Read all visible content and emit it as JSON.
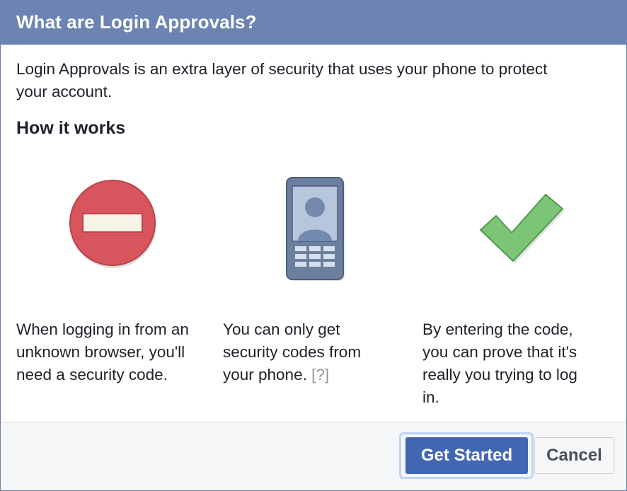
{
  "dialog": {
    "title": "What are Login Approvals?",
    "intro_line1": "Login Approvals is an extra layer of security that uses your phone to protect",
    "intro_line2": "your account.",
    "section_heading": "How it works"
  },
  "steps": [
    {
      "icon": "no-entry-icon",
      "line1": "When logging in from an",
      "line2": "unknown browser, you'll",
      "line3": "need a security code."
    },
    {
      "icon": "phone-icon",
      "line1": "You can only get",
      "line2": "security codes from",
      "line3": "your phone.",
      "help_link": "[?]"
    },
    {
      "icon": "checkmark-icon",
      "line1": "By entering the code,",
      "line2": "you can prove that it's",
      "line3": "really you trying to log",
      "line4": "in."
    }
  ],
  "footer": {
    "primary_label": "Get Started",
    "cancel_label": "Cancel"
  },
  "colors": {
    "header_bg": "#6b84b4",
    "primary_button": "#4267b2",
    "no_entry_red": "#d9555e",
    "check_green": "#7cc576",
    "phone_frame": "#6b7f9e"
  }
}
